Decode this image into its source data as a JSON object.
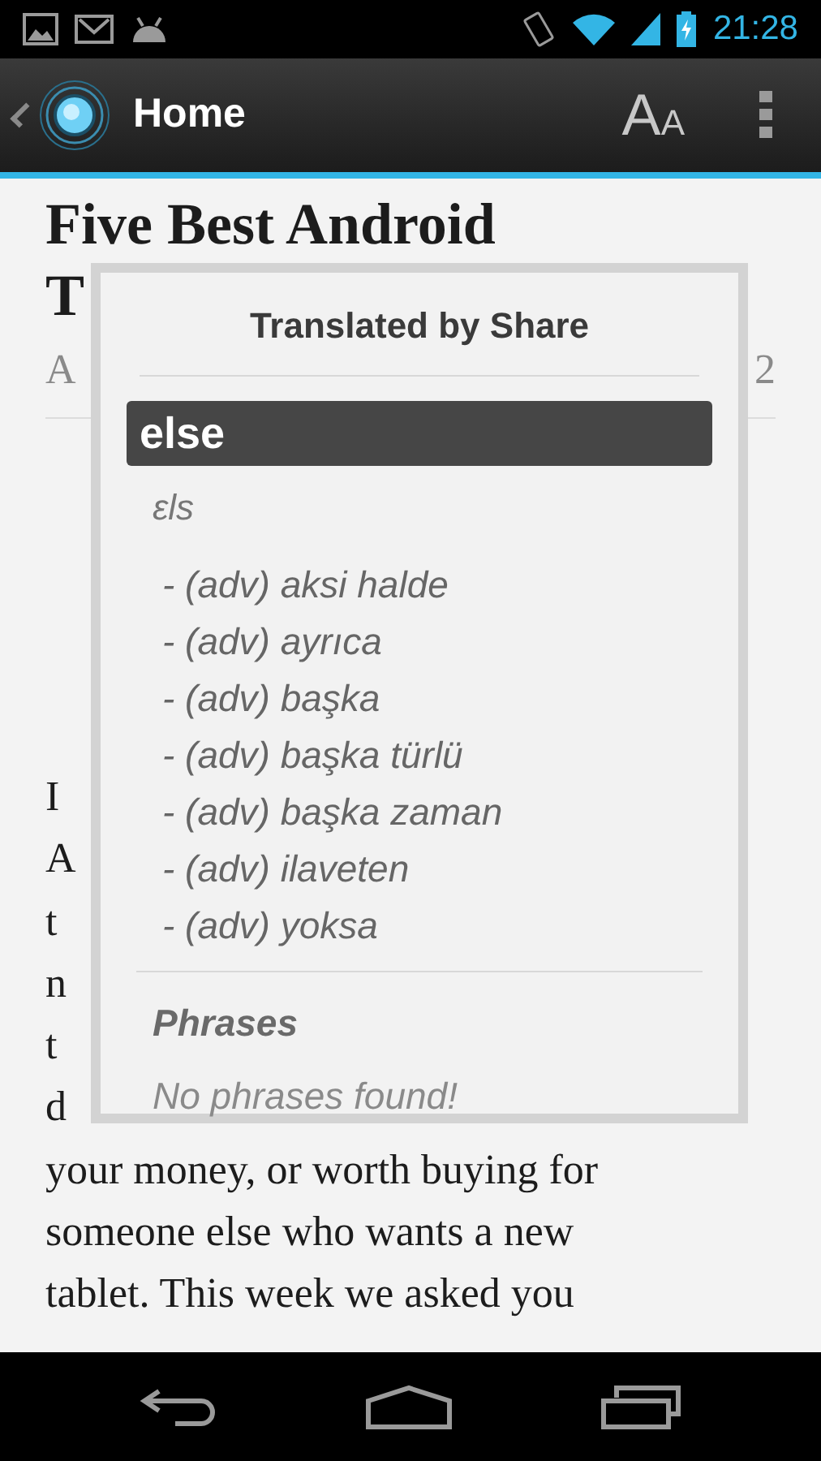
{
  "status_bar": {
    "time": "21:28"
  },
  "action_bar": {
    "title": "Home",
    "font_button": {
      "large": "A",
      "small": "A"
    }
  },
  "article": {
    "title_lines": [
      "Five Best Android",
      "T"
    ],
    "byline_start": "A",
    "byline_end": "2",
    "covered_lines": [
      "I",
      "A",
      "t",
      "n",
      "t",
      "d"
    ],
    "body_lines": [
      "your money, or worth buying for",
      "someone else who wants a new",
      "tablet. This week we asked you"
    ]
  },
  "dialog": {
    "title": "Translated by Share",
    "word": "else",
    "phonetic": "ɛls",
    "meanings": [
      "- (adv) aksi halde",
      "- (adv) ayrıca",
      "- (adv) başka",
      "- (adv) başka türlü",
      "- (adv) başka zaman",
      "- (adv) ilaveten",
      "- (adv) yoksa"
    ],
    "phrases_heading": "Phrases",
    "phrases_empty": "No phrases found!"
  }
}
